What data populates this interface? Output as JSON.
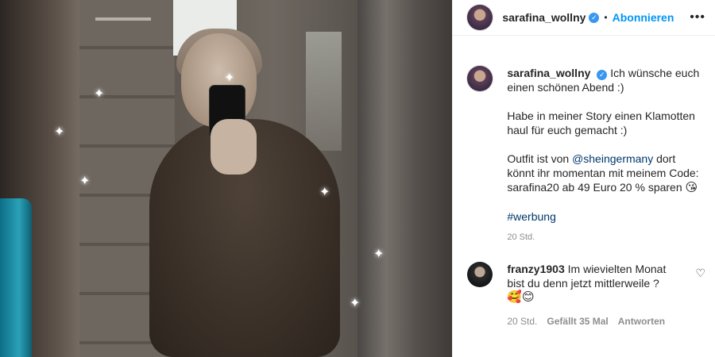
{
  "header": {
    "username": "sarafina_wollny",
    "verified_icon": "verified-badge-icon",
    "separator": "•",
    "follow_label": "Abonnieren",
    "more_icon": "more-options-icon",
    "more_glyph": "•••"
  },
  "caption": {
    "username": "sarafina_wollny",
    "line1": "Ich wünsche euch einen schönen Abend :)",
    "line2": "Habe in meiner Story einen Klamotten haul für euch gemacht :)",
    "line3_prefix": "Outfit ist von",
    "mention": "@sheingermany",
    "line3_suffix": "dort könnt ihr momentan mit meinem Code: sarafina20 ab 49 Euro 20 % sparen",
    "line3_emoji": "😘",
    "hashtag": "#werbung",
    "time": "20 Std."
  },
  "comments": [
    {
      "username": "franzy1903",
      "text": "Im wievielten Monat bist du denn jetzt mittlerweile ?",
      "emojis": "🥰😊",
      "time": "20 Std.",
      "likes": "Gefällt 35 Mal",
      "reply_label": "Antworten",
      "like_glyph": "♡"
    }
  ],
  "photo": {
    "sparkle_glyph": "✦"
  },
  "colors": {
    "accent": "#0095f6",
    "verified": "#3897f0",
    "muted": "#8e8e8e",
    "link": "#00376b"
  }
}
